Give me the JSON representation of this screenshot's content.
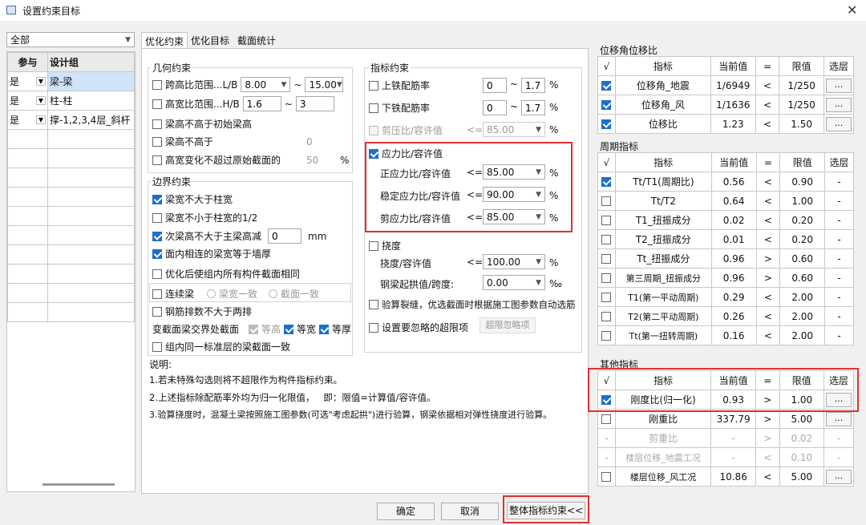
{
  "window": {
    "title": "设置约束目标"
  },
  "left": {
    "filter": "全部",
    "table": {
      "headers": [
        "参与",
        "设计组"
      ],
      "rows": [
        {
          "join": "是",
          "group": "梁-梁"
        },
        {
          "join": "是",
          "group": "柱-柱"
        },
        {
          "join": "是",
          "group": "撑-1,2,3,4层_斜杆"
        }
      ]
    }
  },
  "tabs": [
    "优化约束",
    "优化目标",
    "截面统计"
  ],
  "geo": {
    "title": "几何约束",
    "span_label": "跨高比范围...L/B",
    "span_min": "8.00",
    "span_max": "15.00",
    "hb_label": "高宽比范围...H/B",
    "hb_min": "1.6",
    "hb_max": "3",
    "tilde": "~",
    "beam_not_higher_init": "梁高不高于初始梁高",
    "beam_not_higher": "梁高不高于",
    "beam_not_higher_val": "0",
    "hb_change": "高宽变化不超过原始截面的",
    "hb_change_val": "50",
    "pct": "%"
  },
  "bound": {
    "title": "边界约束",
    "b1": "梁宽不大于柱宽",
    "b2": "梁宽不小于柱宽的1/2",
    "b3": "次梁高不大于主梁高减",
    "b3_val": "0",
    "mm": "mm",
    "b4": "面内相连的梁宽等于墙厚",
    "b5": "优化后使组内所有构件截面相同",
    "b6": "连续梁",
    "b6_opt1": "梁宽一致",
    "b6_opt2": "截面一致",
    "b7": "钢筋排数不大于两排",
    "b8": "变截面梁交界处截面",
    "b8_o1": "等高",
    "b8_o2": "等宽",
    "b8_o3": "等厚",
    "b9": "组内同一标准层的梁截面一致"
  },
  "idx": {
    "title": "指标约束",
    "top_rebar": "上铁配筋率",
    "bot_rebar": "下铁配筋率",
    "r_min": "0",
    "r_max": "1.7",
    "pct": "%",
    "shear_comp": "剪压比/容许值",
    "le": "<=",
    "shear_comp_val": "85.00",
    "stress": "应力比/容许值",
    "s1": "正应力比/容许值",
    "s1_val": "85.00",
    "s2": "稳定应力比/容许值",
    "s2_val": "90.00",
    "s3": "剪应力比/容许值",
    "s3_val": "85.00",
    "defl": "挠度",
    "defl_ratio": "挠度/容许值",
    "defl_val": "100.00",
    "camber": "钢梁起拱值/跨度:",
    "camber_val": "0.00",
    "permil": "‰",
    "crack": "验算裂缝，优选截面时根据施工图参数自动选筋",
    "ignore": "设置要忽略的超限项",
    "ignore_btn": "超限忽略项"
  },
  "notes": {
    "title": "说明:",
    "n1": "1.若未特殊勾选则将不超限作为构件指标约束。",
    "n2": "2.上述指标除配筋率外均为归一化限值，   即：限值=计算值/容许值。",
    "n3": "3.验算挠度时，混凝土梁按照施工图参数(可选\"考虑起拱\")进行验算，钢梁依据相对弹性挠度进行验算。"
  },
  "right": {
    "disp_title": "位移角位移比",
    "headers": [
      "√",
      "指标",
      "当前值",
      "=",
      "限值",
      "选层"
    ],
    "more": "...",
    "dash": "-",
    "disp": [
      {
        "name": "位移角_地震",
        "cur": "1/6949",
        "op": "<",
        "lim": "1/250",
        "checked": true
      },
      {
        "name": "位移角_风",
        "cur": "1/1636",
        "op": "<",
        "lim": "1/250",
        "checked": true
      },
      {
        "name": "位移比",
        "cur": "1.23",
        "op": "<",
        "lim": "1.50",
        "checked": true
      }
    ],
    "period_title": "周期指标",
    "period": [
      {
        "name": "Tt/T1(周期比)",
        "cur": "0.56",
        "op": "<",
        "lim": "0.90",
        "checked": true
      },
      {
        "name": "Tt/T2",
        "cur": "0.64",
        "op": "<",
        "lim": "1.00",
        "checked": false
      },
      {
        "name": "T1_扭振成分",
        "cur": "0.02",
        "op": "<",
        "lim": "0.20",
        "checked": false
      },
      {
        "name": "T2_扭振成分",
        "cur": "0.01",
        "op": "<",
        "lim": "0.20",
        "checked": false
      },
      {
        "name": "Tt_扭振成分",
        "cur": "0.96",
        "op": ">",
        "lim": "0.60",
        "checked": false
      },
      {
        "name": "第三周期_扭振成分",
        "cur": "0.96",
        "op": ">",
        "lim": "0.60",
        "checked": false
      },
      {
        "name": "T1(第一平动周期)",
        "cur": "0.29",
        "op": "<",
        "lim": "2.00",
        "checked": false
      },
      {
        "name": "T2(第二平动周期)",
        "cur": "0.26",
        "op": "<",
        "lim": "2.00",
        "checked": false
      },
      {
        "name": "Tt(第一扭转周期)",
        "cur": "0.16",
        "op": "<",
        "lim": "2.00",
        "checked": false
      }
    ],
    "other_title": "其他指标",
    "other": [
      {
        "name": "刚度比(归一化)",
        "cur": "0.93",
        "op": ">",
        "lim": "1.00",
        "checked": true,
        "enabled": true
      },
      {
        "name": "刚重比",
        "cur": "337.79",
        "op": ">",
        "lim": "5.00",
        "checked": false,
        "enabled": true
      },
      {
        "name": "剪重比",
        "cur": "-",
        "op": ">",
        "lim": "0.02",
        "checked": false,
        "enabled": false
      },
      {
        "name": "楼层位移_地震工况",
        "cur": "-",
        "op": "<",
        "lim": "0.10",
        "checked": false,
        "enabled": false
      },
      {
        "name": "楼层位移_风工况",
        "cur": "10.86",
        "op": "<",
        "lim": "5.00",
        "checked": false,
        "enabled": true
      }
    ]
  },
  "buttons": {
    "ok": "确定",
    "cancel": "取消",
    "overall": "整体指标约束<<"
  }
}
